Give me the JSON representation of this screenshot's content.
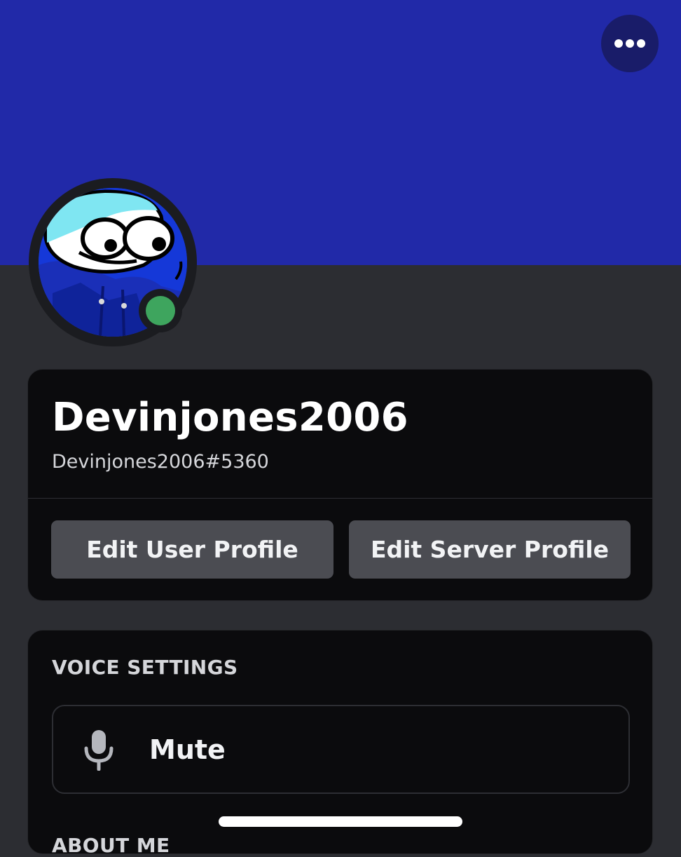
{
  "profile": {
    "display_name": "Devinjones2006",
    "user_tag": "Devinjones2006#5360",
    "status": "online"
  },
  "header": {
    "more_icon": "more-horizontal-icon"
  },
  "actions": {
    "edit_user_profile": "Edit User Profile",
    "edit_server_profile": "Edit Server Profile"
  },
  "voice_settings": {
    "title": "VOICE SETTINGS",
    "mute_label": "Mute",
    "mute_icon": "microphone-icon"
  },
  "about_me": {
    "title": "ABOUT ME"
  },
  "colors": {
    "banner": "#2129a8",
    "background": "#2c2d32",
    "card": "#0b0b0d",
    "button": "#4b4c52",
    "status_online": "#3ea55e"
  }
}
